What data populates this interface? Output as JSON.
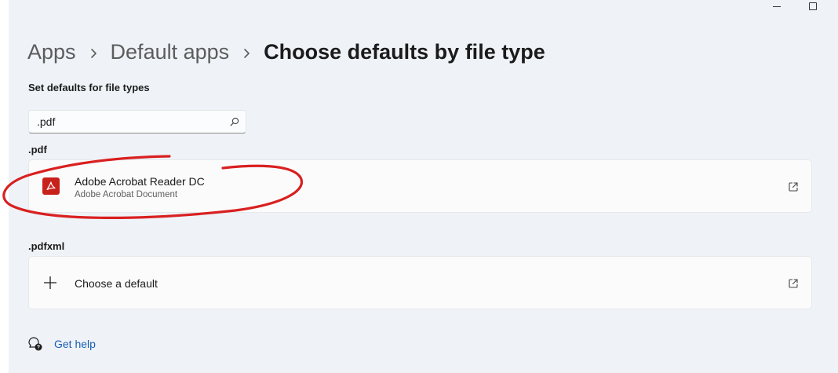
{
  "window": {
    "controls": {
      "minimize_icon": "minimize-icon",
      "maximize_icon": "maximize-icon"
    }
  },
  "breadcrumb": {
    "items": [
      "Apps",
      "Default apps",
      "Choose defaults by file type"
    ]
  },
  "section_title": "Set defaults for file types",
  "search": {
    "value": ".pdf",
    "icon": "search-icon"
  },
  "file_types": [
    {
      "extension": ".pdf",
      "app_name": "Adobe Acrobat Reader DC",
      "app_description": "Adobe Acrobat Document",
      "app_icon": "acrobat-icon",
      "action_icon": "open-external-icon"
    },
    {
      "extension": ".pdfxml",
      "default_label": "Choose a default",
      "default_icon": "plus-icon",
      "action_icon": "open-external-icon"
    }
  ],
  "help": {
    "label": "Get help",
    "icon": "help-chat-icon"
  },
  "colors": {
    "background": "#eff3f8",
    "card": "#fbfbfc",
    "acrobat_red": "#c8211c",
    "link": "#1a5fb4",
    "annotation_red": "#d92020"
  }
}
